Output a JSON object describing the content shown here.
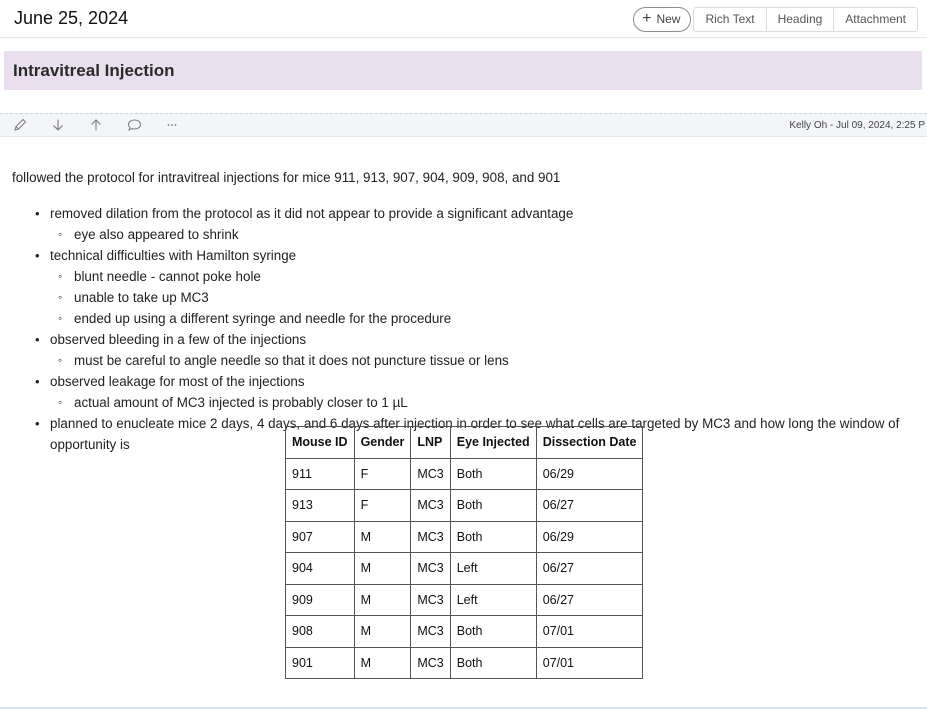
{
  "header": {
    "date": "June 25, 2024",
    "new_label": "New",
    "tabs": [
      "Rich Text",
      "Heading",
      "Attachment"
    ]
  },
  "section": {
    "title": "Intravitreal Injection"
  },
  "entry": {
    "icons": [
      "pencil-icon",
      "arrow-down-icon",
      "arrow-up-icon",
      "comment-icon",
      "more-icon"
    ],
    "meta": "Kelly Oh - Jul 09, 2024, 2:25 P"
  },
  "content": {
    "intro": "followed the protocol for intravitreal injections for mice 911, 913, 907, 904, 909, 908, and 901",
    "bullets": [
      {
        "text": "removed dilation from the protocol as it did not appear to provide a significant advantage",
        "sub": [
          "eye also appeared to shrink"
        ]
      },
      {
        "text": "technical difficulties with Hamilton syringe",
        "sub": [
          "blunt needle - cannot poke hole",
          "unable to take up MC3",
          "ended up using a different syringe and needle for the procedure"
        ]
      },
      {
        "text": "observed bleeding in a few of the injections",
        "sub": [
          "must be careful to angle needle so that it does not puncture tissue or lens"
        ]
      },
      {
        "text": "observed leakage for most of the injections",
        "sub": [
          "actual amount of MC3 injected is probably closer to 1 µL"
        ]
      },
      {
        "text": "planned to enucleate mice 2 days, 4 days, and 6 days after injection in order to see what cells are targeted by MC3 and how long the window of opportunity is",
        "sub": []
      }
    ]
  },
  "table": {
    "headers": [
      "Mouse ID",
      "Gender",
      "LNP",
      "Eye Injected",
      "Dissection Date"
    ],
    "rows": [
      [
        "911",
        "F",
        "MC3",
        "Both",
        "06/29"
      ],
      [
        "913",
        "F",
        "MC3",
        "Both",
        "06/27"
      ],
      [
        "907",
        "M",
        "MC3",
        "Both",
        "06/29"
      ],
      [
        "904",
        "M",
        "MC3",
        "Left",
        "06/27"
      ],
      [
        "909",
        "M",
        "MC3",
        "Left",
        "06/27"
      ],
      [
        "908",
        "M",
        "MC3",
        "Both",
        "07/01"
      ],
      [
        "901",
        "M",
        "MC3",
        "Both",
        "07/01"
      ]
    ]
  }
}
